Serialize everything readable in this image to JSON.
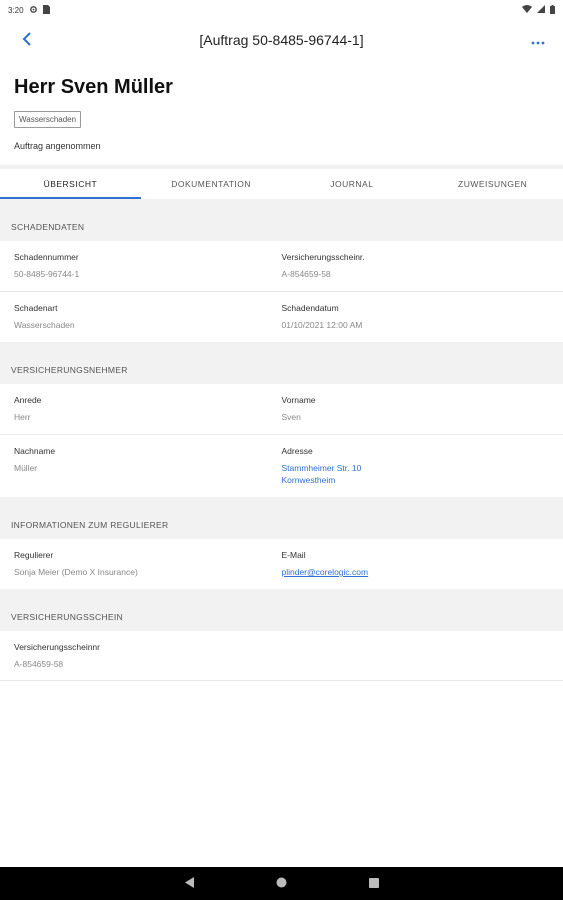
{
  "status_bar": {
    "time": "3:20",
    "left_icons": [
      "gear-icon",
      "sim-icon"
    ],
    "right_icons": [
      "wifi-icon",
      "signal-icon",
      "battery-icon"
    ]
  },
  "app_bar": {
    "title": "[Auftrag 50-8485-96744-1]",
    "back_icon": "chevron-left-icon",
    "more_icon": "more-horizontal-icon",
    "accent_color": "#2f6fd6"
  },
  "header": {
    "customer_name": "Herr Sven Müller",
    "chip": "Wasserschaden",
    "status": "Auftrag angenommen"
  },
  "tabs": [
    {
      "label": "ÜBERSICHT",
      "active": true
    },
    {
      "label": "DOKUMENTATION",
      "active": false
    },
    {
      "label": "JOURNAL",
      "active": false
    },
    {
      "label": "ZUWEISUNGEN",
      "active": false
    }
  ],
  "sections": {
    "schadendaten": {
      "title": "SCHADENDATEN",
      "schadennummer_label": "Schadennummer",
      "schadennummer_value": "50-8485-96744-1",
      "versicherungsscheinnr_label": "Versicherungsscheinr.",
      "versicherungsscheinnr_value": "A-854659-58",
      "schadenart_label": "Schadenart",
      "schadenart_value": "Wasserschaden",
      "schadendatum_label": "Schadendatum",
      "schadendatum_value": "01/10/2021 12:00 AM"
    },
    "versicherungsnehmer": {
      "title": "VERSICHERUNGSNEHMER",
      "anrede_label": "Anrede",
      "anrede_value": "Herr",
      "vorname_label": "Vorname",
      "vorname_value": "Sven",
      "nachname_label": "Nachname",
      "nachname_value": "Müller",
      "adresse_label": "Adresse",
      "adresse_line1": "Stammheimer Str. 10",
      "adresse_line2": "Kornwestheim"
    },
    "regulierer": {
      "title": "INFORMATIONEN ZUM REGULIERER",
      "regulierer_label": "Regulierer",
      "regulierer_value": "Sonja Meier (Demo X Insurance)",
      "email_label": "E-Mail",
      "email_value": "plinder@corelogic.com"
    },
    "versicherungsschein": {
      "title": "VERSICHERUNGSSCHEIN",
      "versicherungsscheinnr_label": "Versicherungsscheinnr",
      "versicherungsscheinnr_value": "A-854659-58"
    }
  },
  "nav_bar": {
    "icons": [
      "back-triangle-icon",
      "home-circle-icon",
      "recents-square-icon"
    ]
  }
}
